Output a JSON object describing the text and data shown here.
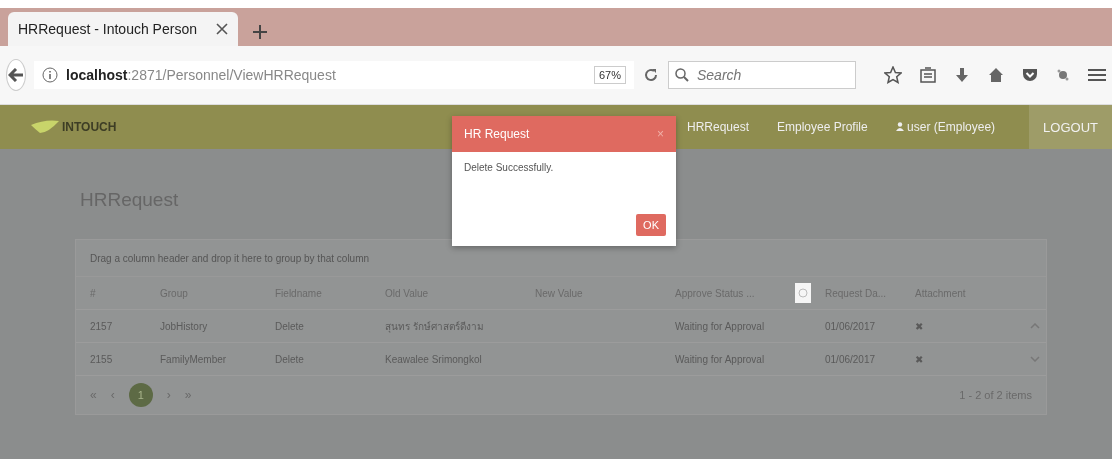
{
  "browser": {
    "tab_title": "HRRequest - Intouch Person",
    "url_host": "localhost",
    "url_path": ":2871/Personnel/ViewHRRequest",
    "zoom": "67%",
    "search": {
      "placeholder": "Search"
    }
  },
  "app": {
    "logo": "INTOUCH",
    "nav": [
      "HRRequest",
      "Employee Profile"
    ],
    "user": "user (Employee)",
    "logout": "LOGOUT"
  },
  "page_title": "HRRequest",
  "grid": {
    "group_hint": "Drag a column header and drop it here to group by that column",
    "columns": [
      "#",
      "Group",
      "Fieldname",
      "Old Value",
      "New Value",
      "Approve Status ...",
      "Request Da...",
      "Attachment"
    ],
    "rows": [
      {
        "cells": [
          "2157",
          "JobHistory",
          "Delete",
          "สุนทร รักษ์ศาสตร์ดีงาม",
          "",
          "Waiting for Approval",
          "01/06/2017",
          "✖"
        ]
      },
      {
        "cells": [
          "2155",
          "FamilyMember",
          "Delete",
          "Keawalee Srimongkol",
          "",
          "Waiting for Approval",
          "01/06/2017",
          "✖"
        ]
      }
    ],
    "pager": {
      "first": "«",
      "prev": "‹",
      "pages": [
        {
          "label": "1",
          "selected": true
        }
      ],
      "next": "›",
      "last": "»",
      "info": "1 - 2 of 2 items"
    }
  },
  "dialog": {
    "title": "HR Request",
    "close": "×",
    "message": "Delete Successfully.",
    "ok": "OK"
  }
}
